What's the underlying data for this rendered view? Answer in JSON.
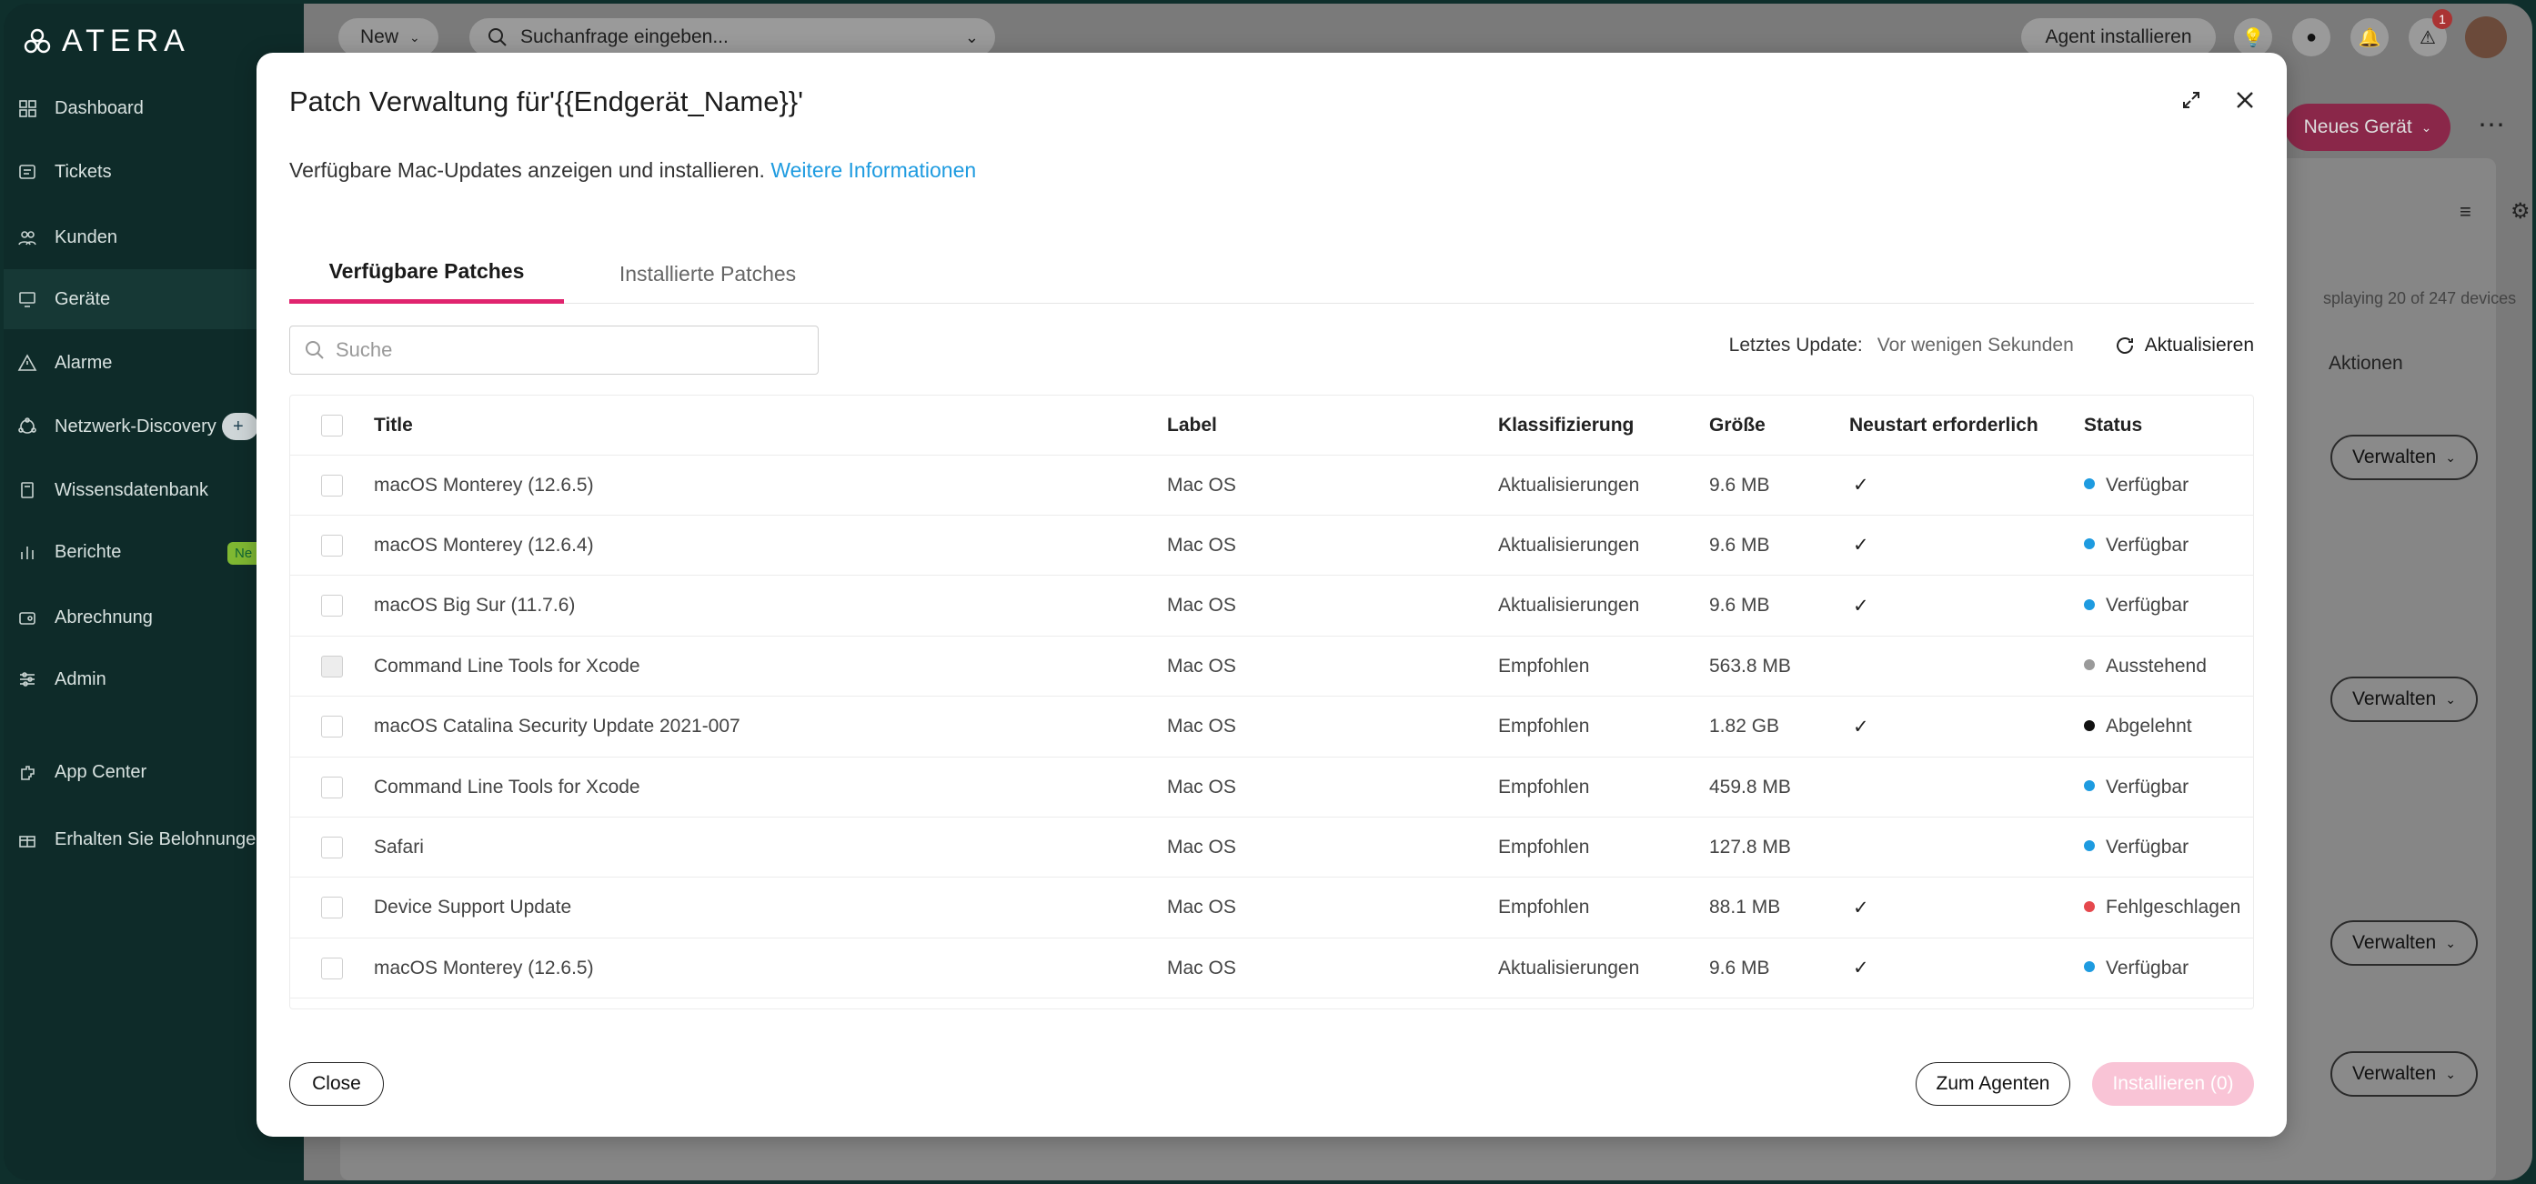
{
  "app": {
    "logo_text": "ATERA"
  },
  "sidebar": {
    "items": [
      {
        "label": "Dashboard",
        "icon": "dashboard-icon"
      },
      {
        "label": "Tickets",
        "icon": "tickets-icon"
      },
      {
        "label": "Kunden",
        "icon": "customers-icon"
      },
      {
        "label": "Geräte",
        "icon": "devices-icon",
        "active": true
      },
      {
        "label": "Alarme",
        "icon": "alert-icon"
      },
      {
        "label": "Netzwerk-Discovery",
        "icon": "network-icon",
        "badge": "+"
      },
      {
        "label": "Wissensdatenbank",
        "icon": "knowledge-icon"
      },
      {
        "label": "Berichte",
        "icon": "reports-icon",
        "badge": "Ne"
      },
      {
        "label": "Abrechnung",
        "icon": "billing-icon"
      },
      {
        "label": "Admin",
        "icon": "admin-icon"
      },
      {
        "label": "App Center",
        "icon": "app-center-icon"
      },
      {
        "label": "Erhalten Sie Belohnungen",
        "icon": "gift-icon"
      }
    ]
  },
  "topbar": {
    "new_label": "New",
    "search_placeholder": "Suchanfrage eingeben...",
    "install_agent_label": "Agent installieren",
    "notification_count": "1"
  },
  "background": {
    "new_device_label": "Neues Gerät",
    "displaying_text": "splaying 20 of 247 devices",
    "actions_header": "Aktionen",
    "manage_label": "Verwalten"
  },
  "modal": {
    "title": "Patch Verwaltung für'{{Endgerät_Name}}'",
    "description": "Verfügbare Mac-Updates anzeigen und installieren.",
    "more_info_link": "Weitere Informationen",
    "tabs": [
      {
        "label": "Verfügbare Patches",
        "active": true
      },
      {
        "label": "Installierte Patches",
        "active": false
      }
    ],
    "search_placeholder": "Suche",
    "last_update_label": "Letztes Update:",
    "last_update_value": "Vor wenigen Sekunden",
    "refresh_label": "Aktualisieren",
    "table": {
      "columns": [
        "Title",
        "Label",
        "Klassifizierung",
        "Größe",
        "Neustart erforderlich",
        "Status"
      ],
      "rows": [
        {
          "title": "macOS Monterey (12.6.5)",
          "label": "Mac OS",
          "class": "Aktualisierungen",
          "size": "9.6 MB",
          "restart": "✓",
          "status": "Verfügbar",
          "status_color": "#1e9be0"
        },
        {
          "title": "macOS Monterey (12.6.4)",
          "label": "Mac OS",
          "class": "Aktualisierungen",
          "size": "9.6 MB",
          "restart": "✓",
          "status": "Verfügbar",
          "status_color": "#1e9be0"
        },
        {
          "title": "macOS Big Sur (11.7.6)",
          "label": "Mac OS",
          "class": "Aktualisierungen",
          "size": "9.6 MB",
          "restart": "✓",
          "status": "Verfügbar",
          "status_color": "#1e9be0"
        },
        {
          "title": "Command Line Tools for Xcode",
          "label": "Mac OS",
          "class": "Empfohlen",
          "size": "563.8 MB",
          "restart": "",
          "status": "Ausstehend",
          "status_color": "#9a9a9a",
          "disabled": true
        },
        {
          "title": "macOS Catalina Security Update 2021-007",
          "label": "Mac OS",
          "class": "Empfohlen",
          "size": "1.82 GB",
          "restart": "✓",
          "status": "Abgelehnt",
          "status_color": "#111111"
        },
        {
          "title": "Command Line Tools for Xcode",
          "label": "Mac OS",
          "class": "Empfohlen",
          "size": "459.8 MB",
          "restart": "",
          "status": "Verfügbar",
          "status_color": "#1e9be0"
        },
        {
          "title": "Safari",
          "label": "Mac OS",
          "class": "Empfohlen",
          "size": "127.8 MB",
          "restart": "",
          "status": "Verfügbar",
          "status_color": "#1e9be0"
        },
        {
          "title": "Device Support Update",
          "label": "Mac OS",
          "class": "Empfohlen",
          "size": "88.1 MB",
          "restart": "✓",
          "status": "Fehlgeschlagen",
          "status_color": "#e5484d"
        },
        {
          "title": "macOS Monterey (12.6.5)",
          "label": "Mac OS",
          "class": "Aktualisierungen",
          "size": "9.6 MB",
          "restart": "✓",
          "status": "Verfügbar",
          "status_color": "#1e9be0"
        }
      ]
    },
    "close_label": "Close",
    "to_agent_label": "Zum Agenten",
    "install_label": "Installieren (0)",
    "colors": {
      "accent": "#e0246e",
      "link": "#1e9be0"
    }
  }
}
